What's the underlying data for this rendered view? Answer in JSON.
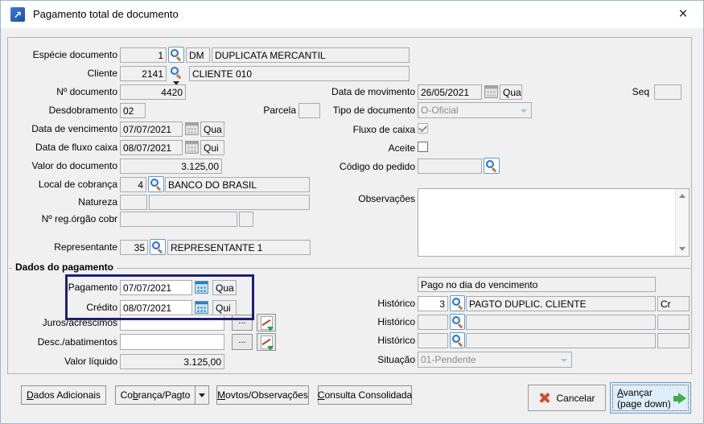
{
  "window": {
    "title": "Pagamento total de documento",
    "app_icon_glyph": "↗",
    "close_glyph": "×"
  },
  "left": {
    "especie": {
      "label": "Espécie documento",
      "value": "1",
      "code": "DM",
      "desc": "DUPLICATA MERCANTIL"
    },
    "cliente": {
      "label": "Cliente",
      "value": "2141",
      "desc": "CLIENTE 010"
    },
    "num_documento": {
      "label": "Nº documento",
      "value": "4420"
    },
    "desdobramento": {
      "label": "Desdobramento",
      "value": "02"
    },
    "parcela": {
      "label": "Parcela",
      "value": ""
    },
    "data_vencimento": {
      "label": "Data de vencimento",
      "value": "07/07/2021",
      "day": "Qua"
    },
    "data_fluxo_caixa": {
      "label": "Data de fluxo caixa",
      "value": "08/07/2021",
      "day": "Qui"
    },
    "valor_documento": {
      "label": "Valor do documento",
      "value": "3.125,00"
    },
    "local_cobranca": {
      "label": "Local de cobrança",
      "value": "4",
      "desc": "BANCO DO BRASIL"
    },
    "natureza": {
      "label": "Natureza",
      "value": "",
      "desc": ""
    },
    "num_reg_orgao": {
      "label": "Nº reg.órgão cobr",
      "value": "",
      "value2": ""
    },
    "representante": {
      "label": "Representante",
      "value": "35",
      "desc": "REPRESENTANTE 1"
    }
  },
  "right": {
    "data_movimento": {
      "label": "Data de movimento",
      "value": "26/05/2021",
      "day": "Qua"
    },
    "seq": {
      "label": "Seq",
      "value": ""
    },
    "tipo_documento": {
      "label": "Tipo de documento",
      "value": "O-Oficial"
    },
    "fluxo_caixa": {
      "label": "Fluxo de caixa",
      "checked": true
    },
    "aceite": {
      "label": "Aceite",
      "checked": false
    },
    "codigo_pedido": {
      "label": "Código do pedido",
      "value": ""
    },
    "observacoes": {
      "label": "Observações",
      "value": ""
    }
  },
  "pagamento": {
    "legend": "Dados do pagamento",
    "pagamento": {
      "label": "Pagamento",
      "value": "07/07/2021",
      "day": "Qua"
    },
    "credito": {
      "label": "Crédito",
      "value": "08/07/2021",
      "day": "Qui"
    },
    "juros": {
      "label": "Juros/acréscimos",
      "value": ""
    },
    "descontos": {
      "label": "Desc./abatimentos",
      "value": ""
    },
    "valor_liquido": {
      "label": "Valor líquido",
      "value": "3.125,00"
    },
    "pago_info": "Pago no dia do vencimento",
    "historicos": [
      {
        "label": "Histórico",
        "value": "3",
        "desc": "PAGTO DUPLIC. CLIENTE",
        "tipo": "Cr"
      },
      {
        "label": "Histórico",
        "value": "",
        "desc": "",
        "tipo": ""
      },
      {
        "label": "Histórico",
        "value": "",
        "desc": "",
        "tipo": ""
      }
    ],
    "situacao": {
      "label": "Situação",
      "value": "01-Pendente"
    }
  },
  "buttons": {
    "ellipsis": "...",
    "dados_adicionais": "Dados Adicionais",
    "cobranca_pagto": "Cobrança/Pagto",
    "movtos_observacoes": "Movtos/Observações",
    "consulta_consolidada": "Consulta Consolidada",
    "cancelar": "Cancelar",
    "avancar_line1": "Avançar",
    "avancar_line2": "(page down)"
  },
  "colors": {
    "highlight_box": "#1e1e78",
    "accent_blue": "#2e7bc8",
    "cancel_red": "#d6492f",
    "advance_green": "#3fae49"
  }
}
